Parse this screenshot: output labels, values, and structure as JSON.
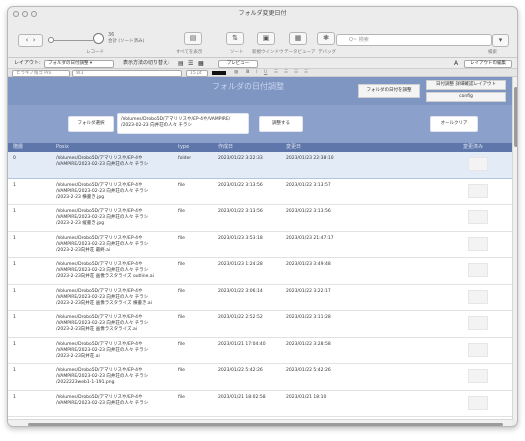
{
  "window": {
    "title": "フォルダ変更日付"
  },
  "toolbar": {
    "record_label": "レコード",
    "records_count": "36",
    "records_sub": "合計 (ソート済み)",
    "show_all_label": "すべてを表示",
    "sort_label": "ソート",
    "new_window_label": "新規ウインドウ",
    "data_viewer_label": "データビューア",
    "debug_label": "デバッグ",
    "search_placeholder": "Q~ 検索",
    "search_label": "検索"
  },
  "layoutbar": {
    "layout_label": "レイアウト:",
    "layout_value": "フォルダの日付調整",
    "view_label": "表示方法の切り替え:",
    "preview_label": "プレビュー",
    "font_size_label": "A",
    "edit_layout_label": "レイアウトの編集"
  },
  "formatbar": {
    "font": "ヒラギノ角ゴ Pro",
    "style": "W3",
    "size": "15 pt",
    "bold": "B",
    "italic": "I",
    "underline": "U"
  },
  "app": {
    "title": "フォルダの日付調整",
    "adjust_folder_date": "フォルダの日付を調整",
    "date_adjust_layout": "日付調整 詳細確認レイアウト",
    "config": "config",
    "folder_select": "フォルダ選択",
    "folder_path": "/Volumes/Drobo5D/アマリリスや/EP-4や/VAMPIRE/\n/2023-02-23 向井荘の人々 チラシ",
    "adjust_button": "調整する",
    "all_clear": "オールクリア"
  },
  "table": {
    "headers": {
      "level": "階層",
      "posix": "Posix",
      "type": "type",
      "created": "作成日",
      "modified": "変更日",
      "changed": "変更済み"
    },
    "rows": [
      {
        "level": "0",
        "posix": "/Volumes/Drobo5D/アマリリスや/EP-4や\n/VAMPIRE/2023-02-23 向井荘の人々 チラシ",
        "type": "folder",
        "created": "2023/01/22 3:22:33",
        "modified": "2023/01/23 22:38:10"
      },
      {
        "level": "1",
        "posix": "/Volumes/Drobo5D/アマリリスや/EP-4や\n/VAMPIRE/2023-02-23 向井荘の人々 チラシ\n/2023-2-23 横書き.jpg",
        "type": "file",
        "created": "2023/01/22 3:13:56",
        "modified": "2023/01/22 3:13:57"
      },
      {
        "level": "1",
        "posix": "/Volumes/Drobo5D/アマリリスや/EP-4や\n/VAMPIRE/2023-02-23 向井荘の人々 チラシ\n/2023-2-23 縦書き.jpg",
        "type": "file",
        "created": "2023/01/22 3:13:56",
        "modified": "2023/01/22 3:13:56"
      },
      {
        "level": "1",
        "posix": "/Volumes/Drobo5D/アマリリスや/EP-4や\n/VAMPIRE/2023-02-23 向井荘の人々 チラシ\n/2023-2-23向井荘 最終.ai",
        "type": "file",
        "created": "2023/01/23 3:53:18",
        "modified": "2023/01/23 21:47:17"
      },
      {
        "level": "1",
        "posix": "/Volumes/Drobo5D/アマリリスや/EP-4や\n/VAMPIRE/2023-02-23 向井荘の人々 チラシ\n/2023-2-23向井荘 画像ラスタライズ outline.ai",
        "type": "file",
        "created": "2023/01/23 1:24:28",
        "modified": "2023/01/23 3:49:48"
      },
      {
        "level": "1",
        "posix": "/Volumes/Drobo5D/アマリリスや/EP-4や\n/VAMPIRE/2023-02-23 向井荘の人々 チラシ\n/2023-2-23向井荘 画像ラスタライズ 横書き.ai",
        "type": "file",
        "created": "2023/01/22 3:06:14",
        "modified": "2023/01/22 3:22:17"
      },
      {
        "level": "1",
        "posix": "/Volumes/Drobo5D/アマリリスや/EP-4や\n/VAMPIRE/2023-02-23 向井荘の人々 チラシ\n/2023-2-23向井荘 画像ラスタライズ.ai",
        "type": "file",
        "created": "2023/01/22 2:52:52",
        "modified": "2023/01/22 3:11:28"
      },
      {
        "level": "1",
        "posix": "/Volumes/Drobo5D/アマリリスや/EP-4や\n/VAMPIRE/2023-02-23 向井荘の人々 チラシ\n/2023-2-23向井荘.ai",
        "type": "file",
        "created": "2023/01/21 17:04:40",
        "modified": "2023/01/22 3:28:58"
      },
      {
        "level": "1",
        "posix": "/Volumes/Drobo5D/アマリリスや/EP-4や\n/VAMPIRE/2023-02-23 向井荘の人々 チラシ\n/2022223web1-1-191.png",
        "type": "file",
        "created": "2023/01/22 5:42:26",
        "modified": "2023/01/22 5:42:26"
      },
      {
        "level": "1",
        "posix": "/Volumes/Drobo5D/アマリリスや/EP-4や\n/VAMPIRE/2023-02-23 向井荘の人々 チラシ",
        "type": "file",
        "created": "2023/01/21 18:02:58",
        "modified": "2023/01/21 18:10"
      }
    ]
  }
}
